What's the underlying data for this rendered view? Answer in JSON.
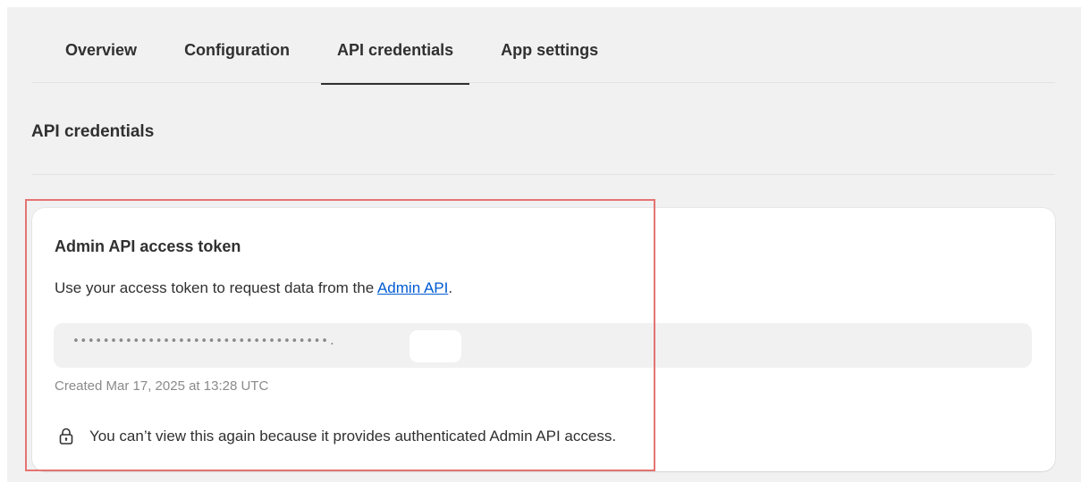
{
  "tabs": [
    {
      "label": "Overview",
      "active": false
    },
    {
      "label": "Configuration",
      "active": false
    },
    {
      "label": "API credentials",
      "active": true
    },
    {
      "label": "App settings",
      "active": false
    }
  ],
  "section": {
    "title": "API credentials"
  },
  "card": {
    "title": "Admin API access token",
    "description_prefix": "Use your access token to request data from the ",
    "description_link": "Admin API",
    "description_suffix": ".",
    "token_masked": "••••••••••••••••••••••••••••••••••.",
    "created": "Created Mar 17, 2025 at 13:28 UTC",
    "notice": "You can’t view this again because it provides authenticated Admin API access.",
    "notice_icon": "lock-icon"
  },
  "colors": {
    "background": "#f1f1f1",
    "card": "#ffffff",
    "link": "#005bd3",
    "highlight": "#e57373",
    "muted_text": "#8a8a8a"
  }
}
